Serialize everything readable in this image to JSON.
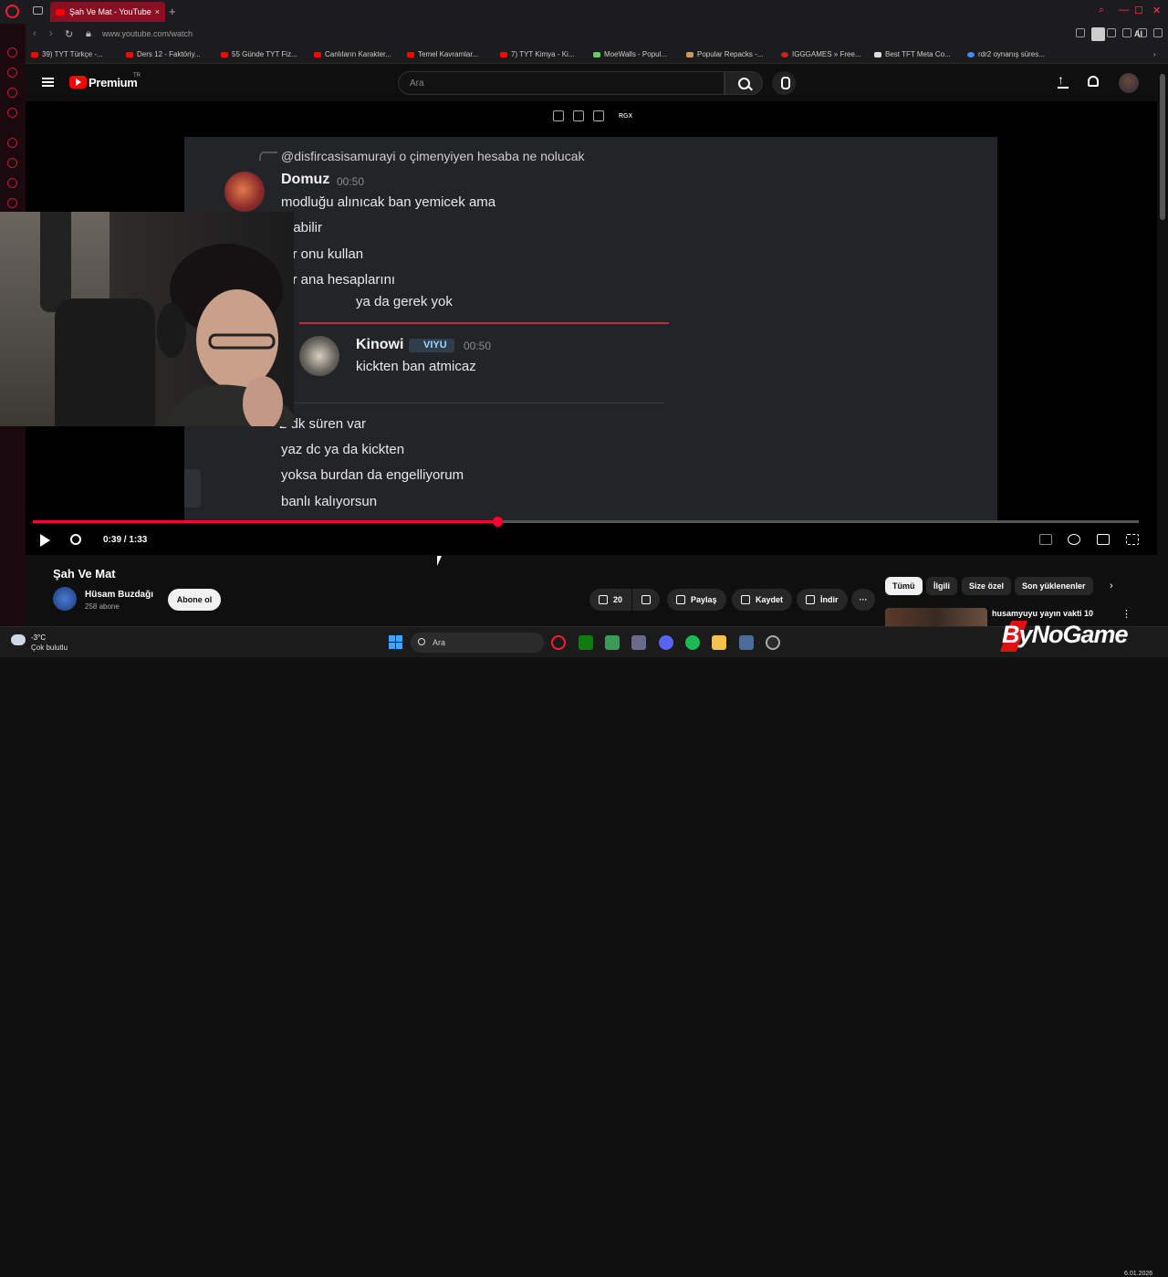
{
  "browser": {
    "tab_title": "Şah Ve Mat - YouTube",
    "url": "www.youtube.com/watch",
    "ai_label": "AI",
    "bookmarks": [
      "39) TYT Türkçe -...",
      "Ders 12 - Faktöriy...",
      "55 Günde TYT Fiz...",
      "Canlıların Karakter...",
      "Temel Kavramlar...",
      "7) TYT Kimya - Ki...",
      "MoeWalls - Popul...",
      "Popular Repacks -...",
      "IGGGAMES » Free...",
      "Best TFT Meta Co...",
      "rdr2 oynanış süres..."
    ]
  },
  "youtube": {
    "logo_text": "Premium",
    "logo_region": "TR",
    "search_placeholder": "Ara",
    "player_tool_label": "RGX"
  },
  "discord": {
    "reply_text": "@disfircasisamurayi o çimenyiyen hesaba ne nolucak",
    "messages": [
      {
        "author": "Domuz",
        "time": "00:50",
        "lines": [
          "modluğu alınıcak ban yemicek ama",
          "urabilir",
          "ter onu kullan",
          "ter ana hesaplarını"
        ]
      },
      {
        "author": "",
        "time": "",
        "lines": [
          "ya da gerek yok"
        ]
      },
      {
        "author": "Kinowi",
        "badge": "VIYU",
        "time": "00:50",
        "lines": [
          "kickten ban atmicaz"
        ]
      },
      {
        "author": "",
        "time": "",
        "lines": [
          "2 dk süren var",
          "yaz dc ya da kickten",
          "yoksa burdan da engelliyorum",
          "banlı kalıyorsun"
        ]
      }
    ]
  },
  "player": {
    "current_time": "0:39",
    "duration": "1:33",
    "time_display": "0:39 / 1:33",
    "progress_fraction": 0.42
  },
  "video": {
    "title": "Şah Ve Mat",
    "channel": "Hüsam Buzdağı",
    "subscribers": "258 abone",
    "subscribe_label": "Abone ol",
    "like_count": "20",
    "share_label": "Paylaş",
    "save_label": "Kaydet",
    "download_label": "İndir"
  },
  "chips": [
    "Tümü",
    "İlgili",
    "Size özel",
    "Son yüklenenler"
  ],
  "recommendation": {
    "title": "husamyuyu yayın vakti 10"
  },
  "taskbar": {
    "temperature": "-3°C",
    "weather": "Çok bulutlu",
    "search_label": "Ara",
    "date": "6.01.2026",
    "watermark": "ByNoGame"
  },
  "colors": {
    "accent": "#ff0033",
    "yt_red": "#ff0000",
    "opera": "#ff1b2d"
  }
}
